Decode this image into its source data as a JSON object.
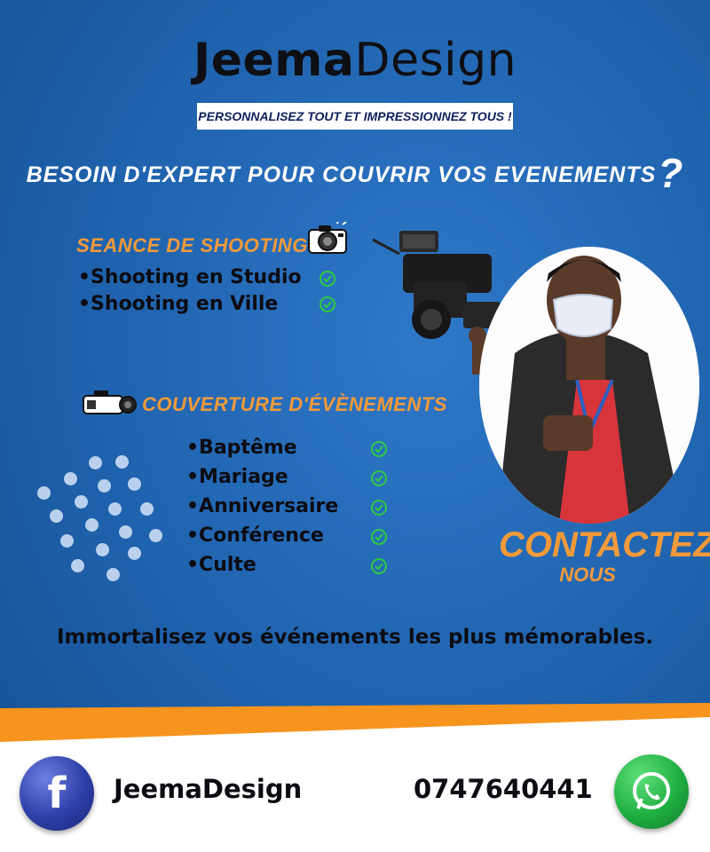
{
  "brand": {
    "bold": "Jeema",
    "regular": "Design"
  },
  "tagline": "PERSONNALISEZ TOUT ET IMPRESSIONNEZ TOUS !",
  "headline": {
    "text": "BESOIN D'EXPERT POUR COUVRIR VOS EVENEMENTS",
    "mark": "?"
  },
  "shooting": {
    "title": "SEANCE DE SHOOTING",
    "icon": "camera-icon",
    "items": [
      "•Shooting en Studio",
      "•Shooting en Ville"
    ]
  },
  "events": {
    "title": "COUVERTURE D'ÉVÈNEMENTS",
    "icon": "video-camera-icon",
    "items": [
      "•Baptême",
      "•Mariage",
      "•Anniversaire",
      "•Conférence",
      "•Culte"
    ]
  },
  "contact": {
    "line1": "CONTACTEZ",
    "line2": "NOUS"
  },
  "slogan": "Immortalisez vos événements les plus mémorables.",
  "footer": {
    "facebook_icon": "facebook-icon",
    "facebook_name": "JeemaDesign",
    "phone": "0747640441",
    "whatsapp_icon": "whatsapp-icon"
  },
  "colors": {
    "background": "#1f62ad",
    "accent": "#f39a3a",
    "check": "#2ecc40",
    "footer_stripe": "#f7941d"
  }
}
